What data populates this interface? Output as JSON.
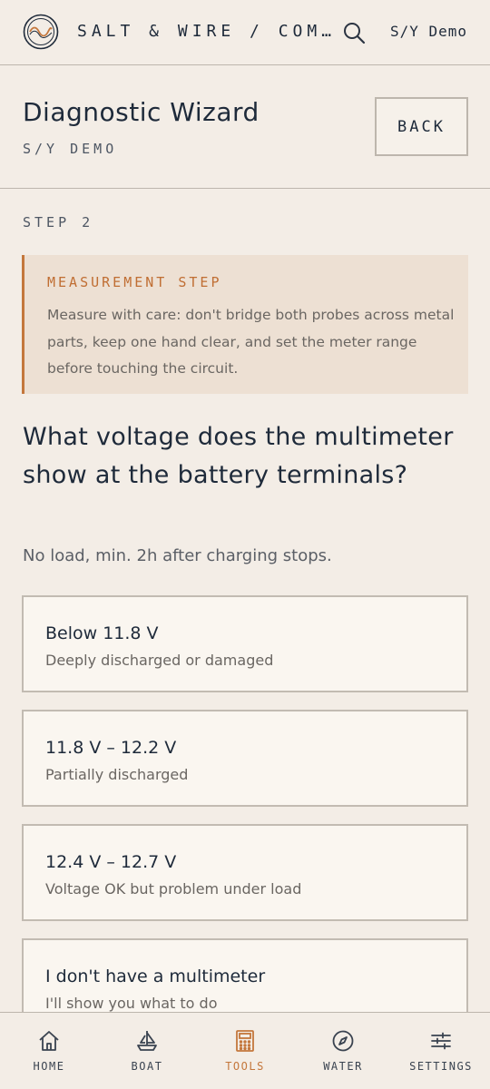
{
  "topbar": {
    "brand": "SALT & WIRE / COM…",
    "vessel": "S/Y Demo",
    "logo_icon": "wave-logo-icon",
    "search_icon": "search-icon"
  },
  "header": {
    "title": "Diagnostic Wizard",
    "subtitle": "S/Y DEMO",
    "back_label": "BACK"
  },
  "step": {
    "label": "STEP 2"
  },
  "note": {
    "title": "MEASUREMENT STEP",
    "text": "Measure with care: don't bridge both probes across metal parts, keep one hand clear, and set the meter range before touching the circuit."
  },
  "question": {
    "text": "What voltage does the multimeter show at the battery terminals?",
    "hint": "No load, min. 2h after charging stops."
  },
  "options": [
    {
      "title": "Below 11.8 V",
      "desc": "Deeply discharged or damaged"
    },
    {
      "title": "11.8 V – 12.2 V",
      "desc": "Partially discharged"
    },
    {
      "title": "12.4 V – 12.7 V",
      "desc": "Voltage OK but problem under load"
    },
    {
      "title": "I don't have a multimeter",
      "desc": "I'll show you what to do"
    }
  ],
  "nav": {
    "items": [
      {
        "label": "HOME",
        "icon": "home-icon"
      },
      {
        "label": "BOAT",
        "icon": "sailboat-icon"
      },
      {
        "label": "TOOLS",
        "icon": "calculator-icon",
        "active": true
      },
      {
        "label": "WATER",
        "icon": "compass-icon"
      },
      {
        "label": "SETTINGS",
        "icon": "sliders-icon"
      }
    ]
  },
  "colors": {
    "background": "#f3ede6",
    "accent": "#c4773c",
    "text": "#1e2a3a",
    "note_bg": "#ede0d3"
  }
}
